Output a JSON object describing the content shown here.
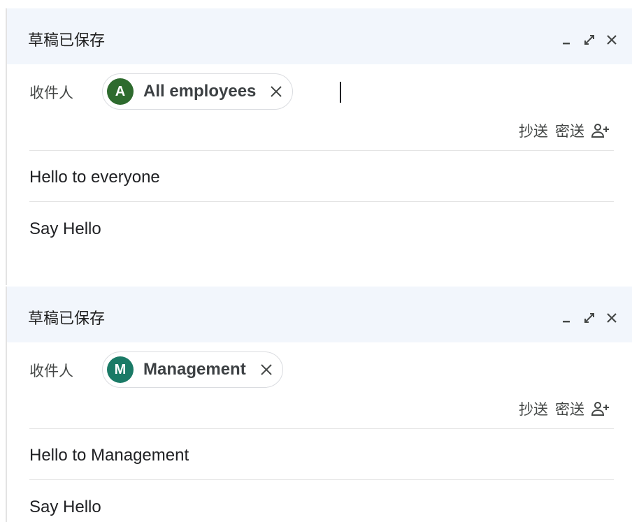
{
  "composes": [
    {
      "title": "草稿已保存",
      "to_label": "收件人",
      "recipient": {
        "initial": "A",
        "name": "All employees",
        "avatar_color": "#2e6b2e"
      },
      "cc_label": "抄送",
      "bcc_label": "密送",
      "subject": "Hello to everyone",
      "body": "Say Hello"
    },
    {
      "title": "草稿已保存",
      "to_label": "收件人",
      "recipient": {
        "initial": "M",
        "name": "Management",
        "avatar_color": "#1a7a66"
      },
      "cc_label": "抄送",
      "bcc_label": "密送",
      "subject": "Hello to Management",
      "body": "Say Hello"
    }
  ],
  "icons": {
    "minimize": "minimize-icon",
    "expand": "expand-icon",
    "close": "close-icon",
    "chip_remove": "close-icon",
    "add_recipients": "person-add-icon"
  },
  "colors": {
    "header_bg": "#f2f6fc",
    "divider": "#e3e3e3"
  }
}
